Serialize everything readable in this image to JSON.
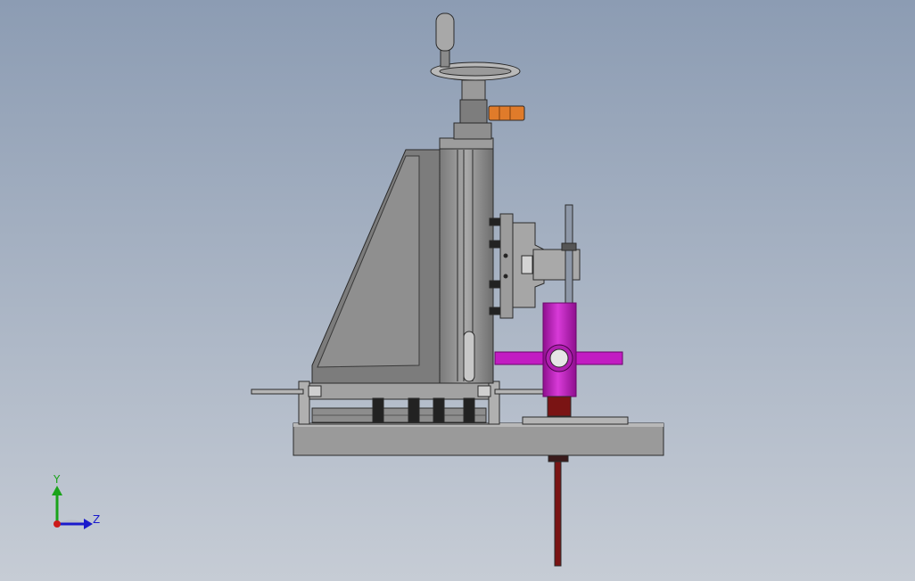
{
  "colors": {
    "background_top": "#8c9cb3",
    "background_bottom": "#c6ccd5",
    "steel": "#8a8a8a",
    "steel_light": "#a7a7a7",
    "steel_dark": "#4e4e4e",
    "accent_orange": "#e07b2a",
    "accent_magenta": "#c21cc2",
    "accent_maroon": "#7a1414",
    "axis_y": "#1aa31a",
    "axis_z": "#1a1acc",
    "axis_origin": "#cc1a1a"
  },
  "triad": {
    "y_label": "Y",
    "z_label": "Z"
  }
}
